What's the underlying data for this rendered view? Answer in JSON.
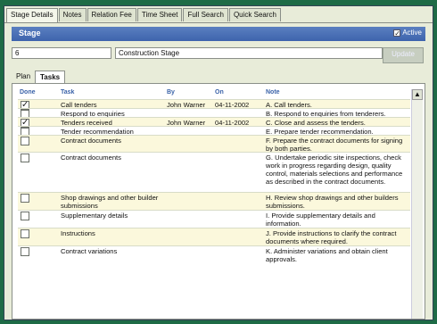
{
  "tabs": [
    "Stage Details",
    "Notes",
    "Relation Fee",
    "Time Sheet",
    "Full Search",
    "Quick Search"
  ],
  "stage": {
    "section_label": "Stage",
    "active_label": "Active",
    "active_checked": true,
    "stage_no": "6",
    "stage_name": "Construction Stage",
    "update_button": "Update"
  },
  "subtabs": [
    "Plan",
    "Tasks"
  ],
  "active_subtab": "Tasks",
  "columns": {
    "done": "Done",
    "task": "Task",
    "by": "By",
    "on": "On",
    "note": "Note"
  },
  "rows": [
    {
      "done": true,
      "task": "Call tenders",
      "by": "John Warner",
      "on": "04-11-2002",
      "note": "A. Call tenders."
    },
    {
      "done": false,
      "task": "Respond to enquiries",
      "by": "",
      "on": "",
      "note": "B. Respond to enquiries from tenderers."
    },
    {
      "done": true,
      "task": "Tenders received",
      "by": "John Warner",
      "on": "04-11-2002",
      "note": "C. Close and assess the tenders."
    },
    {
      "done": false,
      "task": "Tender recommendation",
      "by": "",
      "on": "",
      "note": "E. Prepare tender recommendation."
    },
    {
      "done": false,
      "task": "Contract documents",
      "by": "",
      "on": "",
      "note": "F. Prepare the contract documents for signing by both parties."
    },
    {
      "done": false,
      "task": "Contract documents",
      "by": "",
      "on": "",
      "note": "G. Undertake periodic site inspections, check work in progress regarding design, quality control, materials selections and performance as described in the contract documents."
    },
    {
      "done": false,
      "task": "Shop drawings and other builder submissions",
      "by": "",
      "on": "",
      "note": "H. Review shop drawings and other builders submissions."
    },
    {
      "done": false,
      "task": "Supplementary details",
      "by": "",
      "on": "",
      "note": "I. Provide supplementary details and information."
    },
    {
      "done": false,
      "task": "Instructions",
      "by": "",
      "on": "",
      "note": "J. Provide instructions to clarify the contract documents where required."
    },
    {
      "done": false,
      "task": "Contract variations",
      "by": "",
      "on": "",
      "note": "K. Administer variations and obtain client approvals."
    }
  ]
}
